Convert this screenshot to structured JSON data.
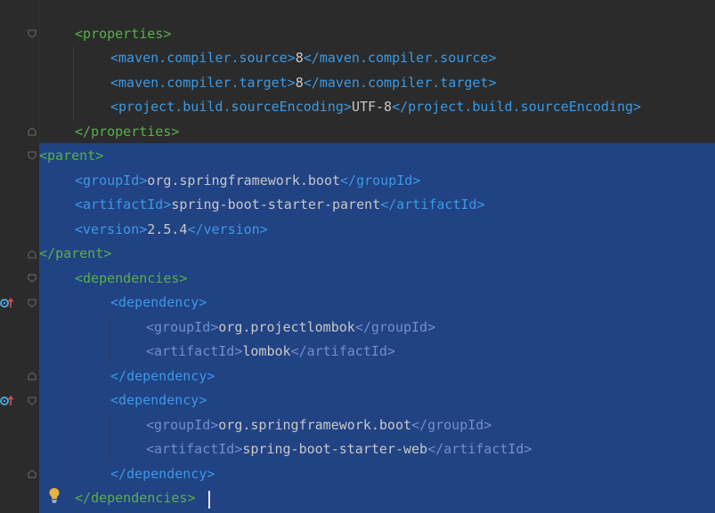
{
  "editor": {
    "lines": [
      {
        "open": "<",
        "tag": "properties",
        "close": ">",
        "text": "",
        "end": "",
        "color": "green"
      },
      {
        "open": "<",
        "tag": "maven.compiler.source",
        "close": ">",
        "text": "8",
        "end": "</maven.compiler.source>",
        "color": "blue"
      },
      {
        "open": "<",
        "tag": "maven.compiler.target",
        "close": ">",
        "text": "8",
        "end": "</maven.compiler.target>",
        "color": "blue"
      },
      {
        "open": "<",
        "tag": "project.build.sourceEncoding",
        "close": ">",
        "text": "UTF-8",
        "end": "</project.build.sourceEncoding>",
        "color": "blue"
      },
      {
        "open": "</",
        "tag": "properties",
        "close": ">",
        "text": "",
        "end": "",
        "color": "green"
      },
      {
        "open": "<",
        "tag": "parent",
        "close": ">",
        "text": "",
        "end": "",
        "color": "green"
      },
      {
        "open": "<",
        "tag": "groupId",
        "close": ">",
        "text": "org.springframework.boot",
        "end": "</groupId>",
        "color": "blue"
      },
      {
        "open": "<",
        "tag": "artifactId",
        "close": ">",
        "text": "spring-boot-starter-parent",
        "end": "</artifactId>",
        "color": "blue"
      },
      {
        "open": "<",
        "tag": "version",
        "close": ">",
        "text": "2.5.4",
        "end": "</version>",
        "color": "blue"
      },
      {
        "open": "</",
        "tag": "parent",
        "close": ">",
        "text": "",
        "end": "",
        "color": "green"
      },
      {
        "open": "<",
        "tag": "dependencies",
        "close": ">",
        "text": "",
        "end": "",
        "color": "green"
      },
      {
        "open": "<",
        "tag": "dependency",
        "close": ">",
        "text": "",
        "end": "",
        "color": "blue"
      },
      {
        "open": "<",
        "tag": "groupId",
        "close": ">",
        "text": "org.projectlombok",
        "end": "</groupId>",
        "color": "dim"
      },
      {
        "open": "<",
        "tag": "artifactId",
        "close": ">",
        "text": "lombok",
        "end": "</artifactId>",
        "color": "dim"
      },
      {
        "open": "</",
        "tag": "dependency",
        "close": ">",
        "text": "",
        "end": "",
        "color": "blue"
      },
      {
        "open": "<",
        "tag": "dependency",
        "close": ">",
        "text": "",
        "end": "",
        "color": "blue"
      },
      {
        "open": "<",
        "tag": "groupId",
        "close": ">",
        "text": "org.springframework.boot",
        "end": "</groupId>",
        "color": "dim"
      },
      {
        "open": "<",
        "tag": "artifactId",
        "close": ">",
        "text": "spring-boot-starter-web",
        "end": "</artifactId>",
        "color": "dim"
      },
      {
        "open": "</",
        "tag": "dependency",
        "close": ">",
        "text": "",
        "end": "",
        "color": "blue"
      },
      {
        "open": "</",
        "tag": "dependencies",
        "close": ">",
        "text": "",
        "end": "",
        "color": "green"
      }
    ]
  },
  "colors": {
    "background": "#2b2b2b",
    "selection": "#214283",
    "tag_green": "#58b04b",
    "tag_blue": "#3b9ae6",
    "tag_dim": "#6f8fd0",
    "text": "#c8c8c8"
  },
  "icons": [
    "fold-marker-icon",
    "run-gutter-icon",
    "lightbulb-icon"
  ]
}
